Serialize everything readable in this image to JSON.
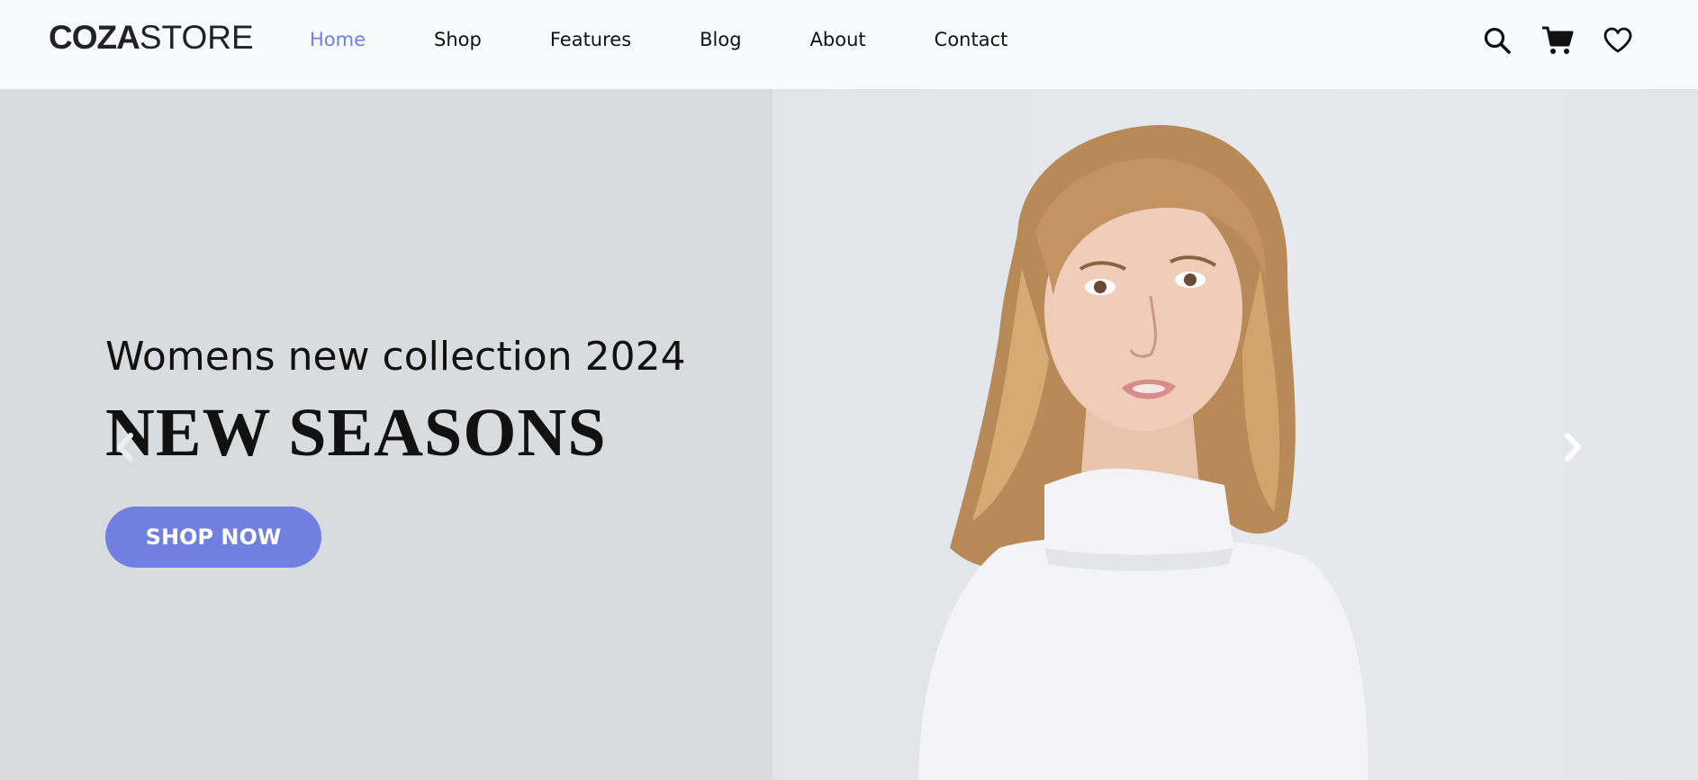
{
  "header": {
    "logo": {
      "strong": "COZA",
      "light": "STORE"
    },
    "nav": [
      {
        "label": "Home",
        "active": true
      },
      {
        "label": "Shop"
      },
      {
        "label": "Features"
      },
      {
        "label": "Blog"
      },
      {
        "label": "About"
      },
      {
        "label": "Contact"
      }
    ],
    "icons": [
      "search-icon",
      "cart-icon",
      "heart-icon"
    ]
  },
  "hero": {
    "subtitle": "Womens new collection 2024",
    "title": "NEW SEASONS",
    "button_label": "SHOP NOW",
    "arrows": [
      "chevron-left-icon",
      "chevron-right-icon"
    ]
  },
  "colors": {
    "accent": "#717fe0",
    "text": "#111111",
    "header_bg": "#f7fbfc",
    "hero_bg": "#d9dcde"
  }
}
